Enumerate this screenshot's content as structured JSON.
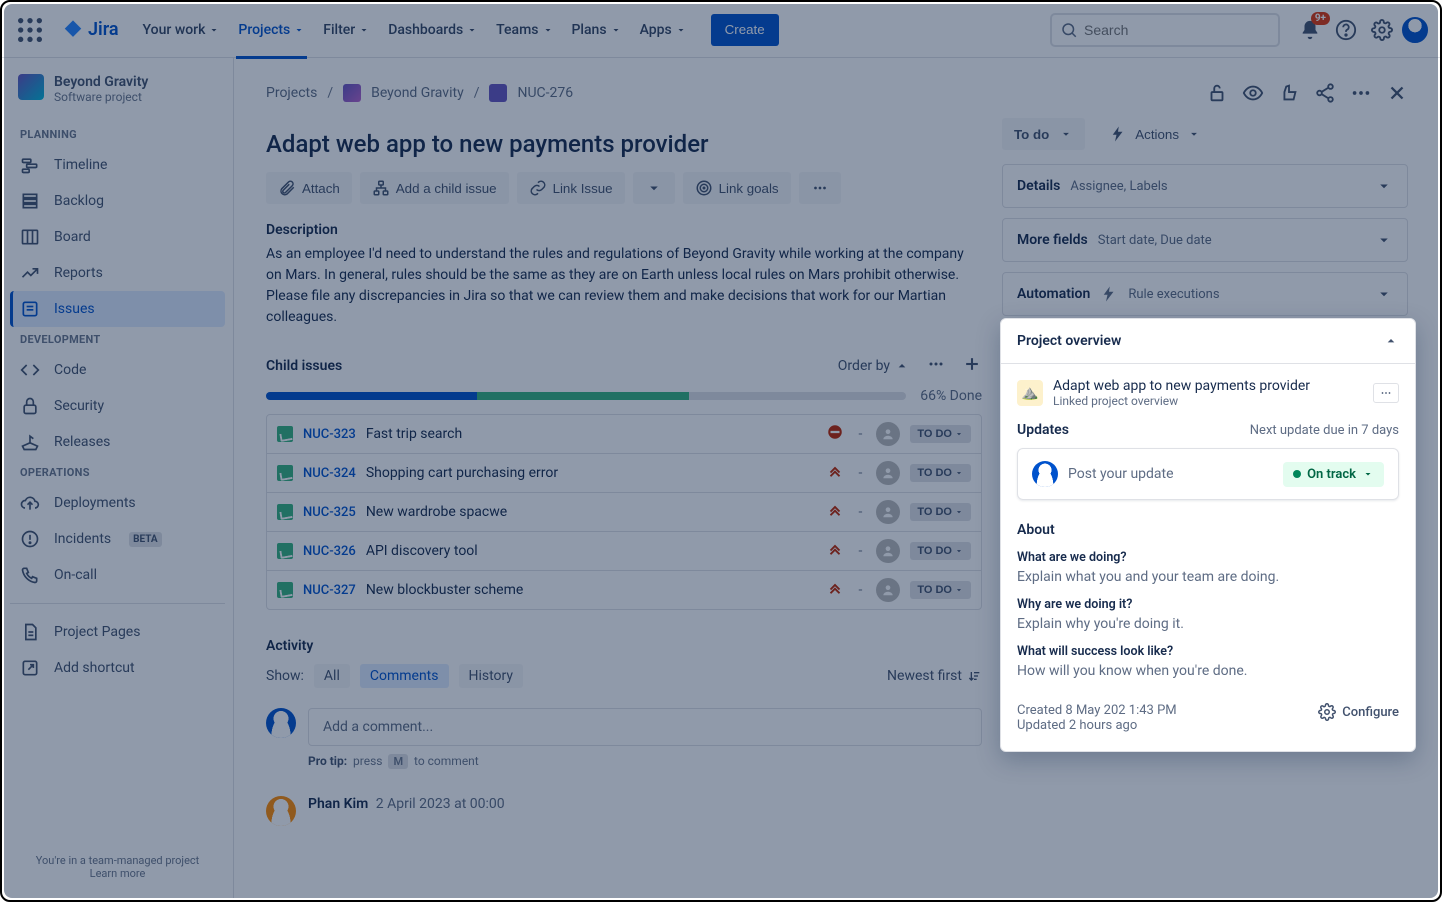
{
  "header": {
    "logo_text": "Jira",
    "nav": [
      {
        "label": "Your work",
        "active": false
      },
      {
        "label": "Projects",
        "active": true
      },
      {
        "label": "Filter",
        "active": false
      },
      {
        "label": "Dashboards",
        "active": false
      },
      {
        "label": "Teams",
        "active": false
      },
      {
        "label": "Plans",
        "active": false
      },
      {
        "label": "Apps",
        "active": false
      }
    ],
    "create": "Create",
    "search_placeholder": "Search",
    "notif_badge": "9+"
  },
  "sidebar": {
    "project_name": "Beyond Gravity",
    "project_sub": "Software project",
    "sections": {
      "planning": "PLANNING",
      "development": "DEVELOPMENT",
      "operations": "OPERATIONS"
    },
    "items": {
      "timeline": "Timeline",
      "backlog": "Backlog",
      "board": "Board",
      "reports": "Reports",
      "issues": "Issues",
      "code": "Code",
      "security": "Security",
      "releases": "Releases",
      "deployments": "Deployments",
      "incidents": "Incidents",
      "incidents_badge": "BETA",
      "oncall": "On-call",
      "pages": "Project Pages",
      "shortcut": "Add shortcut"
    },
    "footer_line1": "You're in a team-managed project",
    "footer_line2": "Learn more"
  },
  "breadcrumb": {
    "projects": "Projects",
    "project": "Beyond Gravity",
    "key": "NUC-276"
  },
  "issue": {
    "title": "Adapt web app to new payments provider",
    "status": "To do",
    "actions_label": "Actions",
    "buttons": {
      "attach": "Attach",
      "child": "Add a child issue",
      "link": "Link Issue",
      "goals": "Link goals"
    },
    "description_head": "Description",
    "description": "As an employee I'd need to understand the rules and regulations of Beyond Gravity while working at the company on Mars. In general, rules should be the same as they are on Earth unless local rules on Mars prohibit otherwise. Please file any discrepancies in Jira so that we can review them and make decisions that work for our Martian colleagues."
  },
  "panels": {
    "details": {
      "title": "Details",
      "sub": "Assignee, Labels"
    },
    "more": {
      "title": "More fields",
      "sub": "Start date, Due date"
    },
    "automation": {
      "title": "Automation",
      "sub": "Rule executions"
    }
  },
  "child": {
    "head": "Child issues",
    "orderby": "Order by",
    "done": "66% Done",
    "items": [
      {
        "key": "NUC-323",
        "sum": "Fast trip search",
        "prio": "blocker",
        "status": "TO DO"
      },
      {
        "key": "NUC-324",
        "sum": "Shopping cart purchasing error",
        "prio": "highest",
        "status": "TO DO"
      },
      {
        "key": "NUC-325",
        "sum": "New wardrobe spacwe",
        "prio": "highest",
        "status": "TO DO"
      },
      {
        "key": "NUC-326",
        "sum": "API discovery tool",
        "prio": "highest",
        "status": "TO DO"
      },
      {
        "key": "NUC-327",
        "sum": "New blockbuster scheme",
        "prio": "highest",
        "status": "TO DO"
      }
    ]
  },
  "activity": {
    "head": "Activity",
    "show": "Show:",
    "tabs": {
      "all": "All",
      "comments": "Comments",
      "history": "History"
    },
    "sort": "Newest first",
    "comment_placeholder": "Add a comment...",
    "protip_label": "Pro tip:",
    "protip_press": "press",
    "protip_key": "M",
    "protip_to": "to comment",
    "commenter": "Phan Kim",
    "comment_time": "2 April 2023 at 00:00"
  },
  "overview": {
    "head": "Project overview",
    "linked_title": "Adapt web app to new payments provider",
    "linked_sub": "Linked project overview",
    "updates_head": "Updates",
    "next_update": "Next update due in 7 days",
    "post_placeholder": "Post your update",
    "track_label": "On track",
    "about_head": "About",
    "q1": "What are we doing?",
    "a1": "Explain what you and your team are doing.",
    "q2": "Why are we doing it?",
    "a2": "Explain why you're doing it.",
    "q3": "What will success look like?",
    "a3": "How will you know when you're done.",
    "created": "Created 8 May 202 1:43 PM",
    "updated": "Updated 2 hours ago",
    "configure": "Configure"
  }
}
